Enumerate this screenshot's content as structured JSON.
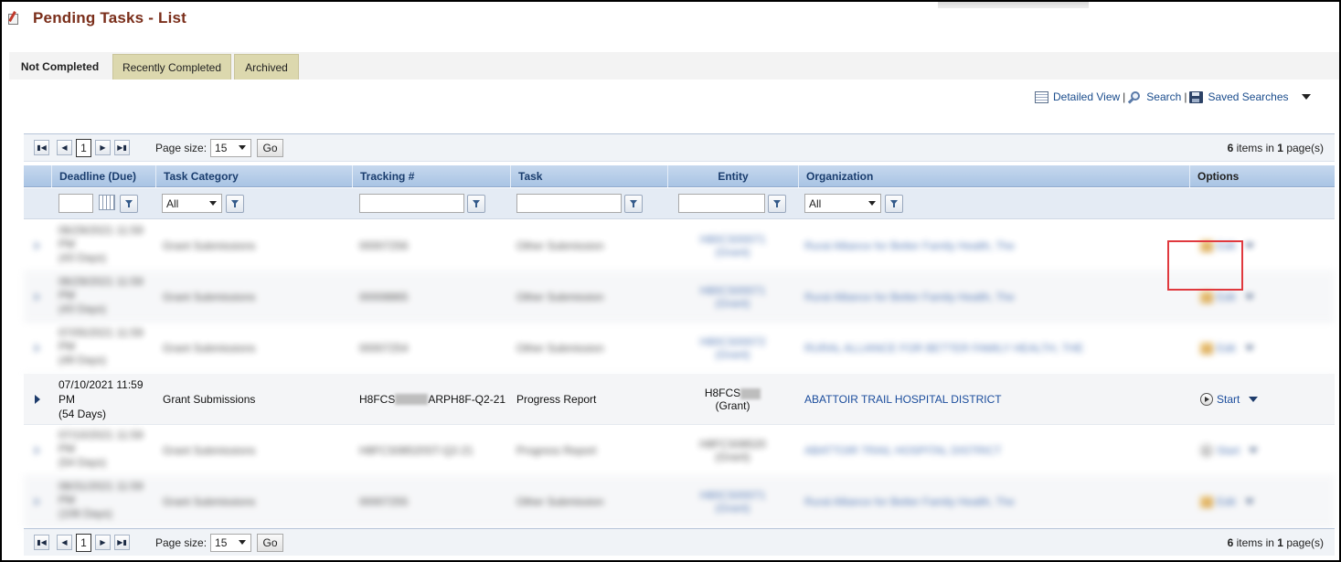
{
  "page": {
    "title": "Pending Tasks - List"
  },
  "tabs": [
    {
      "label": "Not Completed",
      "active": true
    },
    {
      "label": "Recently Completed",
      "active": false
    },
    {
      "label": "Archived",
      "active": false
    }
  ],
  "toolbar": {
    "detailed_view": "Detailed View",
    "search": "Search",
    "saved_searches": "Saved Searches",
    "separator": "|"
  },
  "pager": {
    "current_page": "1",
    "page_size_label": "Page size:",
    "page_size": "15",
    "go_label": "Go",
    "items_count": "6",
    "items_text": "items in",
    "pages_count": "1",
    "pages_text": "page(s)"
  },
  "columns": {
    "deadline": "Deadline (Due)",
    "task_category": "Task Category",
    "tracking": "Tracking #",
    "task": "Task",
    "entity": "Entity",
    "organization": "Organization",
    "options": "Options"
  },
  "filters": {
    "task_category": "All",
    "organization": "All"
  },
  "rows": [
    {
      "deadline_line1": "06/29/2021 11:59",
      "deadline_line2": "PM",
      "deadline_line3": "(43 Days)",
      "task_category": "Grant Submissions",
      "tracking": "00007256",
      "task": "Other Submission",
      "entity_line1": "H80CS00071",
      "entity_line2": "(Grant)",
      "organization": "Rural Alliance for Better Family Health, The",
      "option": "Edit",
      "blurred": true
    },
    {
      "deadline_line1": "06/29/2021 11:59",
      "deadline_line2": "PM",
      "deadline_line3": "(43 Days)",
      "task_category": "Grant Submissions",
      "tracking": "00008865",
      "task": "Other Submission",
      "entity_line1": "H80CS00071",
      "entity_line2": "(Grant)",
      "organization": "Rural Alliance for Better Family Health, The",
      "option": "Edit",
      "blurred": true
    },
    {
      "deadline_line1": "07/05/2021 11:59",
      "deadline_line2": "PM",
      "deadline_line3": "(49 Days)",
      "task_category": "Grant Submissions",
      "tracking": "00007254",
      "task": "Other Submission",
      "entity_line1": "H80CS00072",
      "entity_line2": "(Grant)",
      "organization": "RURAL ALLIANCE FOR BETTER FAMILY HEALTH, THE",
      "option": "Edit",
      "blurred": true
    },
    {
      "deadline_line1": "07/10/2021 11:59",
      "deadline_line2": "PM",
      "deadline_line3": "(54 Days)",
      "task_category": "Grant Submissions",
      "tracking_prefix": "H8FCS",
      "tracking_suffix": "ARPH8F-Q2-21",
      "task": "Progress Report",
      "entity_line1": "H8FCS",
      "entity_line2": "(Grant)",
      "organization": "ABATTOIR TRAIL HOSPITAL DISTRICT",
      "option": "Start",
      "blurred": false
    },
    {
      "deadline_line1": "07/10/2021 11:59",
      "deadline_line2": "PM",
      "deadline_line3": "(54 Days)",
      "task_category": "Grant Submissions",
      "tracking": "H8FCS08520ST-Q2-21",
      "task": "Progress Report",
      "entity_line1": "H8FCS08520",
      "entity_line2": "(Grant)",
      "organization": "ABATTOIR TRAIL HOSPITAL DISTRICT",
      "option": "Start",
      "blurred": true
    },
    {
      "deadline_line1": "08/31/2021 11:59",
      "deadline_line2": "PM",
      "deadline_line3": "(106 Days)",
      "task_category": "Grant Submissions",
      "tracking": "00007255",
      "task": "Other Submission",
      "entity_line1": "H80CS00071",
      "entity_line2": "(Grant)",
      "organization": "Rural Alliance for Better Family Health, The",
      "option": "Edit",
      "blurred": true
    }
  ]
}
